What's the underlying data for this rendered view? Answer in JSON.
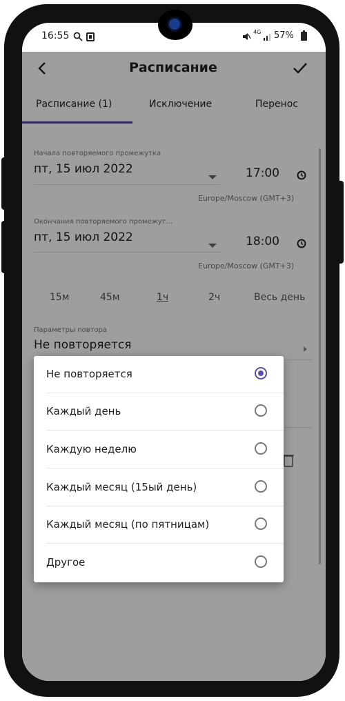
{
  "status_bar": {
    "time": "16:55",
    "battery": "57%",
    "network": "4G"
  },
  "app_bar": {
    "title": "Расписание",
    "back_icon": "arrow-left-icon",
    "confirm_icon": "check-icon"
  },
  "tabs": [
    {
      "label": "Расписание (1)",
      "active": true
    },
    {
      "label": "Исключение",
      "active": false
    },
    {
      "label": "Перенос",
      "active": false
    }
  ],
  "start": {
    "label": "Начала повторяемого промежутка",
    "date": "пт, 15 июл 2022",
    "time": "17:00",
    "timezone": "Europe/Moscow (GMT+3)"
  },
  "end": {
    "label": "Окончания повторяемого промежут...",
    "date": "пт, 15 июл 2022",
    "time": "18:00",
    "timezone": "Europe/Moscow (GMT+3)"
  },
  "durations": [
    {
      "label": "15м",
      "selected": false
    },
    {
      "label": "45м",
      "selected": false
    },
    {
      "label": "1ч",
      "selected": true
    },
    {
      "label": "2ч",
      "selected": false
    },
    {
      "label": "Весь день",
      "selected": false
    }
  ],
  "repeat": {
    "label": "Параметры повтора",
    "value": "Не повторяется"
  },
  "dialog": {
    "options": [
      {
        "label": "Не повторяется",
        "selected": true
      },
      {
        "label": "Каждый день",
        "selected": false
      },
      {
        "label": "Каждую неделю",
        "selected": false
      },
      {
        "label": "Каждый месяц (15ый день)",
        "selected": false
      },
      {
        "label": "Каждый месяц (по пятницам)",
        "selected": false
      },
      {
        "label": "Другое",
        "selected": false
      }
    ]
  },
  "colors": {
    "accent": "#5b4ea8",
    "scrim": "rgba(0,0,0,0.38)"
  }
}
